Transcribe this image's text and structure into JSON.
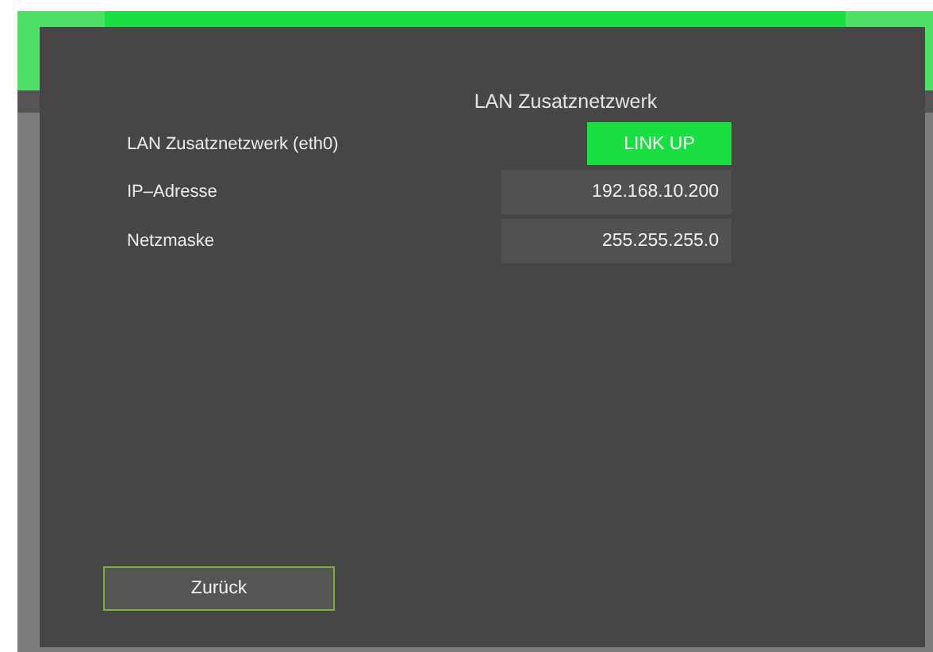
{
  "dialog": {
    "title": "LAN Zusatznetzwerk",
    "rows": [
      {
        "kind": "status",
        "label": "LAN Zusatznetzwerk (eth0)",
        "value": "LINK UP",
        "on": true
      },
      {
        "kind": "field",
        "label": "IP–Adresse",
        "value": "192.168.10.200"
      },
      {
        "kind": "field",
        "label": "Netzmaske",
        "value": "255.255.255.0"
      }
    ],
    "back_button": "Zurück"
  }
}
